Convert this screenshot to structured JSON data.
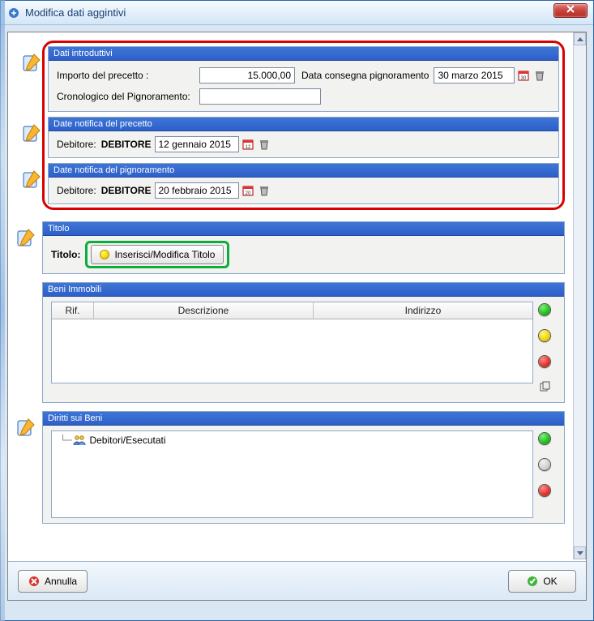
{
  "window": {
    "title": "Modifica dati aggintivi"
  },
  "intro": {
    "header": "Dati introduttivi",
    "importo_label": "Importo del precetto :",
    "importo_value": "15.000,00",
    "data_consegna_label": "Data consegna pignoramento",
    "data_consegna_value": "30 marzo 2015",
    "cronologico_label": "Cronologico del Pignoramento:",
    "cronologico_value": ""
  },
  "precetto": {
    "header": "Date notifica del precetto",
    "debitore_label": "Debitore:",
    "debitore_value": "DEBITORE",
    "date_value": "12 gennaio 2015"
  },
  "pignoramento": {
    "header": "Date notifica del pignoramento",
    "debitore_label": "Debitore:",
    "debitore_value": "DEBITORE",
    "date_value": "20 febbraio 2015"
  },
  "titolo": {
    "header": "Titolo",
    "label": "Titolo:",
    "button": "Inserisci/Modifica Titolo"
  },
  "beni": {
    "header": "Beni Immobili",
    "cols": {
      "rif": "Rif.",
      "descrizione": "Descrizione",
      "indirizzo": "Indirizzo"
    }
  },
  "diritti": {
    "header": "Diritti sui Beni",
    "root": "Debitori/Esecutati"
  },
  "footer": {
    "cancel": "Annulla",
    "ok": "OK"
  }
}
